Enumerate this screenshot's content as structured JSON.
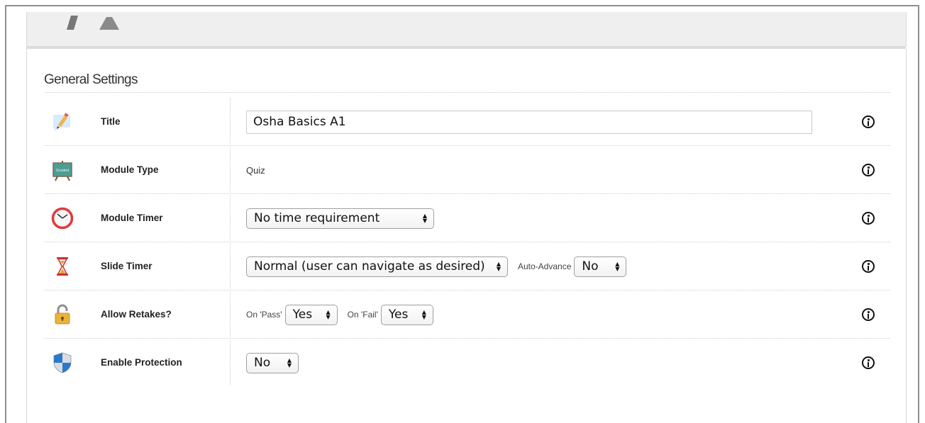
{
  "settings": {
    "section_title": "General Settings",
    "rows": [
      {
        "label": "Title",
        "icon": "pencil-note-icon",
        "value": "Osha Basics A1",
        "info": "info-icon"
      },
      {
        "label": "Module Type",
        "icon": "graded-easel-icon",
        "icon_text": "Graded",
        "value": "Quiz",
        "info": "info-icon"
      },
      {
        "label": "Module Timer",
        "icon": "clock-icon",
        "value": "No time requirement",
        "info": "info-icon"
      },
      {
        "label": "Slide Timer",
        "icon": "hourglass-icon",
        "value": "Normal (user can navigate as desired)",
        "auto_advance_label": "Auto-Advance",
        "auto_advance_value": "No",
        "info": "info-icon"
      },
      {
        "label": "Allow Retakes?",
        "icon": "padlock-icon",
        "on_pass_label": "On 'Pass'",
        "on_pass_value": "Yes",
        "on_fail_label": "On 'Fail'",
        "on_fail_value": "Yes",
        "info": "info-icon"
      },
      {
        "label": "Enable Protection",
        "icon": "shield-icon",
        "value": "No",
        "info": "info-icon"
      }
    ]
  },
  "colors": {
    "panel_border": "#d8d8d8",
    "header_background": "#efefef",
    "clock_ring": "#e03a3a",
    "shield_blue": "#2d78c9"
  }
}
